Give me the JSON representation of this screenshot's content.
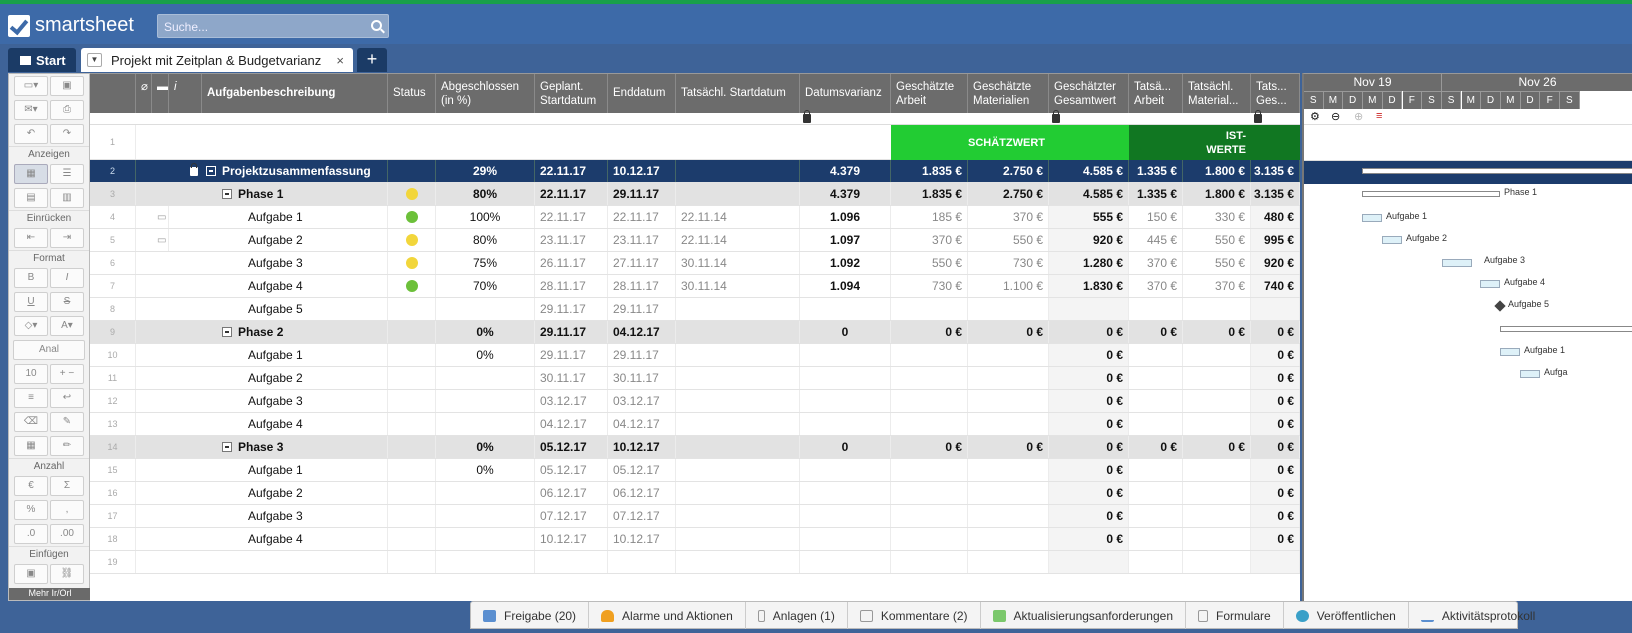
{
  "app": {
    "brand": "smartsheet",
    "search_placeholder": "Suche..."
  },
  "tabs": {
    "home": "Start",
    "sheet": "Projekt mit Zeitplan & Budgetvarianz",
    "add": "+"
  },
  "left_panel": {
    "sec_view": "Anzeigen",
    "sec_indent": "Einrücken",
    "sec_format": "Format",
    "font": "Anal",
    "size": "10",
    "sec_number": "Anzahl",
    "currency": "€",
    "percent": "%",
    "sec_insert": "Einfügen",
    "bottom": "Mehr Ir/Orl"
  },
  "headers": {
    "task": "Aufgabenbeschreibung",
    "status": "Status",
    "complete": "Abgeschlossen (in %)",
    "planstart": "Geplant. Startdatum",
    "end": "Enddatum",
    "actstart": "Tatsächl. Startdatum",
    "variance": "Datumsvarianz",
    "estlabor": "Geschätzte Arbeit",
    "estmat": "Geschätzte Materialien",
    "esttotal": "Geschätzter Gesamtwert",
    "actlabor": "Tatsä... Arbeit",
    "actmat": "Tatsächl. Material...",
    "acttotal": "Tats... Ges..."
  },
  "banner": {
    "estimate": "SCHÄTZWERT",
    "actual1": "IST-",
    "actual2": "WERTE"
  },
  "rows": [
    {
      "n": "1"
    },
    {
      "n": "2",
      "task": "Projektzusammenfassung",
      "complete": "29%",
      "planstart": "22.11.17",
      "end": "10.12.17",
      "variance": "4.379",
      "estlabor": "1.835 €",
      "estmat": "2.750 €",
      "esttotal": "4.585 €",
      "actlabor": "1.335 €",
      "actmat": "1.800 €",
      "acttotal": "3.135 €"
    },
    {
      "n": "3",
      "task": "Phase 1",
      "status": "yellow",
      "complete": "80%",
      "planstart": "22.11.17",
      "end": "29.11.17",
      "variance": "4.379",
      "estlabor": "1.835 €",
      "estmat": "2.750 €",
      "esttotal": "4.585 €",
      "actlabor": "1.335 €",
      "actmat": "1.800 €",
      "acttotal": "3.135 €"
    },
    {
      "n": "4",
      "task": "Aufgabe 1",
      "status": "green",
      "complete": "100%",
      "planstart": "22.11.17",
      "end": "22.11.17",
      "actstart": "22.11.14",
      "variance": "1.096",
      "estlabor": "185 €",
      "estmat": "370 €",
      "esttotal": "555 €",
      "actlabor": "150 €",
      "actmat": "330 €",
      "acttotal": "480 €"
    },
    {
      "n": "5",
      "task": "Aufgabe 2",
      "status": "yellow",
      "complete": "80%",
      "planstart": "23.11.17",
      "end": "23.11.17",
      "actstart": "22.11.14",
      "variance": "1.097",
      "estlabor": "370 €",
      "estmat": "550 €",
      "esttotal": "920 €",
      "actlabor": "445 €",
      "actmat": "550 €",
      "acttotal": "995 €"
    },
    {
      "n": "6",
      "task": "Aufgabe 3",
      "status": "yellow",
      "complete": "75%",
      "planstart": "26.11.17",
      "end": "27.11.17",
      "actstart": "30.11.14",
      "variance": "1.092",
      "estlabor": "550 €",
      "estmat": "730 €",
      "esttotal": "1.280 €",
      "actlabor": "370 €",
      "actmat": "550 €",
      "acttotal": "920 €"
    },
    {
      "n": "7",
      "task": "Aufgabe 4",
      "status": "green",
      "complete": "70%",
      "planstart": "28.11.17",
      "end": "28.11.17",
      "actstart": "30.11.14",
      "variance": "1.094",
      "estlabor": "730 €",
      "estmat": "1.100 €",
      "esttotal": "1.830 €",
      "actlabor": "370 €",
      "actmat": "370 €",
      "acttotal": "740 €"
    },
    {
      "n": "8",
      "task": "Aufgabe 5",
      "planstart": "29.11.17",
      "end": "29.11.17"
    },
    {
      "n": "9",
      "task": "Phase 2",
      "complete": "0%",
      "planstart": "29.11.17",
      "end": "04.12.17",
      "variance": "0",
      "estlabor": "0 €",
      "estmat": "0 €",
      "esttotal": "0 €",
      "actlabor": "0 €",
      "actmat": "0 €",
      "acttotal": "0 €"
    },
    {
      "n": "10",
      "task": "Aufgabe 1",
      "complete": "0%",
      "planstart": "29.11.17",
      "end": "29.11.17",
      "esttotal": "0 €",
      "acttotal": "0 €"
    },
    {
      "n": "11",
      "task": "Aufgabe 2",
      "planstart": "30.11.17",
      "end": "30.11.17",
      "esttotal": "0 €",
      "acttotal": "0 €"
    },
    {
      "n": "12",
      "task": "Aufgabe 3",
      "planstart": "03.12.17",
      "end": "03.12.17",
      "esttotal": "0 €",
      "acttotal": "0 €"
    },
    {
      "n": "13",
      "task": "Aufgabe 4",
      "planstart": "04.12.17",
      "end": "04.12.17",
      "esttotal": "0 €",
      "acttotal": "0 €"
    },
    {
      "n": "14",
      "task": "Phase 3",
      "complete": "0%",
      "planstart": "05.12.17",
      "end": "10.12.17",
      "variance": "0",
      "estlabor": "0 €",
      "estmat": "0 €",
      "esttotal": "0 €",
      "actlabor": "0 €",
      "actmat": "0 €",
      "acttotal": "0 €"
    },
    {
      "n": "15",
      "task": "Aufgabe 1",
      "complete": "0%",
      "planstart": "05.12.17",
      "end": "05.12.17",
      "esttotal": "0 €",
      "acttotal": "0 €"
    },
    {
      "n": "16",
      "task": "Aufgabe 2",
      "planstart": "06.12.17",
      "end": "06.12.17",
      "esttotal": "0 €",
      "acttotal": "0 €"
    },
    {
      "n": "17",
      "task": "Aufgabe 3",
      "planstart": "07.12.17",
      "end": "07.12.17",
      "esttotal": "0 €",
      "acttotal": "0 €"
    },
    {
      "n": "18",
      "task": "Aufgabe 4",
      "planstart": "10.12.17",
      "end": "10.12.17",
      "esttotal": "0 €",
      "acttotal": "0 €"
    },
    {
      "n": "19"
    }
  ],
  "gantt": {
    "week1": "Nov 19",
    "week2": "Nov 26",
    "days": [
      "S",
      "M",
      "D",
      "M",
      "D",
      "F",
      "S",
      "S",
      "M",
      "D",
      "M",
      "D",
      "F",
      "S"
    ],
    "labels": [
      "Phase 1",
      "Aufgabe 1",
      "Aufgabe 2",
      "Aufgabe 3",
      "Aufgabe 4",
      "Aufgabe 5",
      "Aufgabe 1",
      "Aufga"
    ]
  },
  "bottom": {
    "share": "Freigabe (20)",
    "alerts": "Alarme und Aktionen",
    "attach": "Anlagen (1)",
    "comments": "Kommentare (2)",
    "updates": "Aktualisierungsanforderungen",
    "forms": "Formulare",
    "publish": "Veröffentlichen",
    "activity": "Aktivitätsprotokoll"
  },
  "colors": {
    "summary": "#1c3c6c",
    "phase": "#e2e2e2",
    "estimate_banner": "#22cc33",
    "actual_banner": "#117722",
    "green_dot": "#6cc03a",
    "yellow_dot": "#f2d63b"
  }
}
